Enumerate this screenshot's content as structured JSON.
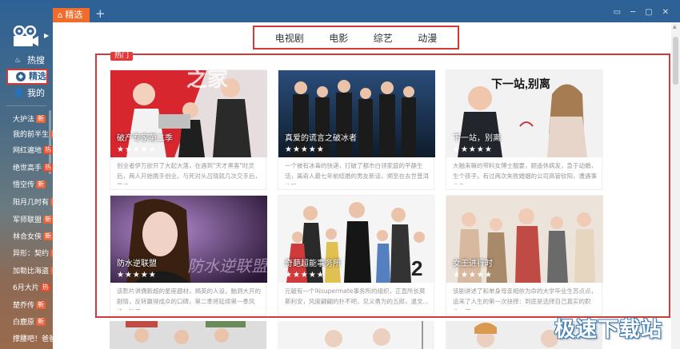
{
  "titlebar": {
    "active_tab": "精选",
    "add_tab": "+",
    "controls": [
      "▭",
      "─",
      "▢",
      "✕"
    ]
  },
  "sidebar": {
    "nav": [
      {
        "label": "热搜",
        "icon": "flame-icon"
      },
      {
        "label": "精选",
        "icon": "compass-icon"
      },
      {
        "label": "我的",
        "icon": "user-icon"
      }
    ],
    "list": [
      {
        "label": "大护法",
        "badge": "新"
      },
      {
        "label": "我的前半生",
        "badge": "新"
      },
      {
        "label": "网红遍地",
        "badge": "热"
      },
      {
        "label": "绝世高手",
        "badge": "热"
      },
      {
        "label": "悟空传",
        "badge": "新"
      },
      {
        "label": "阳月几时有",
        "badge": "新"
      },
      {
        "label": "军师联盟",
        "badge": "新"
      },
      {
        "label": "林合女侠",
        "badge": "新"
      },
      {
        "label": "异形：契约",
        "badge": "新"
      },
      {
        "label": "加勒比海盗",
        "badge": "新"
      },
      {
        "label": "6月大片",
        "badge": "热"
      },
      {
        "label": "楚乔传",
        "badge": "新"
      },
      {
        "label": "白鹿原",
        "badge": "新"
      },
      {
        "label": "撑腰吧！爸爸",
        "badge": ""
      }
    ]
  },
  "categories": [
    "电视剧",
    "电影",
    "综艺",
    "动漫"
  ],
  "hot_tag": "热门",
  "cards": [
    {
      "title": "破产专家第二季",
      "stars": "★★★★★",
      "desc": "创业者伊万欲开了大起大落，在遇到\"天才黑客\"时灵后，两人开始携手创业。与死对头吕晓就几次交手后，最终..."
    },
    {
      "title": "真爱的谎言之破冰者",
      "stars": "★★★★★",
      "desc": "一个被有冰毒的快递，打破了都市白领家庭的平静生活，离奇人最七年前结婚的男友新话，溯至在去世普洱的路..."
    },
    {
      "title": "下一站，别离",
      "stars": "★★★★★",
      "desc": "大融来嘛的带料女博士服要，顾遥休病发，急于动婚，生个孩子。有过两次失败婚姻的公司高管钦阳，遭遇事业危..."
    },
    {
      "title": "防水逆联盟",
      "stars": "★★★★★",
      "desc": "该影片讲偶新超的星座题材，揭英的人设，脑洞大开的剧情，反转赢得成众的口碑，第二季将延续第一季风格，除了..."
    },
    {
      "title": "奇葩超能事务所",
      "stars": "★★★★★",
      "desc": "元毓有一个叫supermate事务所的组织，正直所长莫斯利安，风度翩翩的扑不吧，见义勇为的五郎，温文..."
    },
    {
      "title": "女王进行时",
      "stars": "★★★★★",
      "desc": "该剧讲述了和单身母亲相依为命的大学毕业生苏点点，追来了人生的第一次抉择：到底是选择自己真实的职业，还..."
    }
  ],
  "watermark": "极速下载站"
}
